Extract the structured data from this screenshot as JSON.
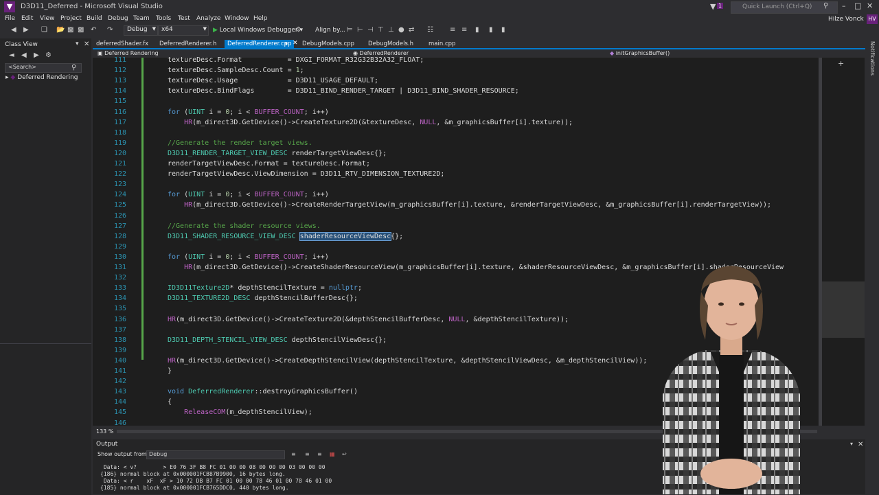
{
  "window": {
    "title": "D3D11_Deferred - Microsoft Visual Studio",
    "notifications_count": "1",
    "quick_launch_placeholder": "Quick Launch (Ctrl+Q)",
    "user": "Hilze Vonck",
    "avatar_initials": "HV"
  },
  "menu": [
    "File",
    "Edit",
    "View",
    "Project",
    "Build",
    "Debug",
    "Team",
    "Tools",
    "Test",
    "Analyze",
    "Window",
    "Help"
  ],
  "toolbar": {
    "configuration": "Debug",
    "platform": "x64",
    "debugger": "Local Windows Debugger",
    "align": "Align by..."
  },
  "class_view": {
    "title": "Class View",
    "search_placeholder": "<Search>",
    "item": "Deferred Rendering"
  },
  "tabs": [
    {
      "label": "deferredShader.fx",
      "active": false
    },
    {
      "label": "DeferredRenderer.h",
      "active": false
    },
    {
      "label": "DeferredRenderer.cpp",
      "active": true
    },
    {
      "label": "DebugModels.cpp",
      "active": false
    },
    {
      "label": "DebugModels.h",
      "active": false
    },
    {
      "label": "main.cpp",
      "active": false
    }
  ],
  "navbar": {
    "project": "Deferred Rendering",
    "scope": "DeferredRenderer",
    "member": "initGraphicsBuffer()"
  },
  "editor": {
    "zoom": "133 %",
    "lines": [
      {
        "n": "111",
        "t": "textureDesc.Format           = DXGI_FORMAT_R32G32B32A32_FLOAT;"
      },
      {
        "n": "112",
        "t": "textureDesc.SampleDesc.Count = 1;"
      },
      {
        "n": "113",
        "t": "textureDesc.Usage            = D3D11_USAGE_DEFAULT;"
      },
      {
        "n": "114",
        "t": "textureDesc.BindFlags        = D3D11_BIND_RENDER_TARGET | D3D11_BIND_SHADER_RESOURCE;"
      },
      {
        "n": "115",
        "t": ""
      },
      {
        "n": "116",
        "t": "for (UINT i = 0; i < BUFFER_COUNT; i++)"
      },
      {
        "n": "117",
        "t": "    HR(m_direct3D.GetDevice()->CreateTexture2D(&textureDesc, NULL, &m_graphicsBuffer[i].texture));"
      },
      {
        "n": "118",
        "t": ""
      },
      {
        "n": "119",
        "t": "//Generate the render target views."
      },
      {
        "n": "120",
        "t": "D3D11_RENDER_TARGET_VIEW_DESC renderTargetViewDesc{};"
      },
      {
        "n": "121",
        "t": "renderTargetViewDesc.Format = textureDesc.Format;"
      },
      {
        "n": "122",
        "t": "renderTargetViewDesc.ViewDimension = D3D11_RTV_DIMENSION_TEXTURE2D;"
      },
      {
        "n": "123",
        "t": ""
      },
      {
        "n": "124",
        "t": "for (UINT i = 0; i < BUFFER_COUNT; i++)"
      },
      {
        "n": "125",
        "t": "    HR(m_direct3D.GetDevice()->CreateRenderTargetView(m_graphicsBuffer[i].texture, &renderTargetViewDesc, &m_graphicsBuffer[i].renderTargetView));"
      },
      {
        "n": "126",
        "t": ""
      },
      {
        "n": "127",
        "t": "//Generate the shader resource views."
      },
      {
        "n": "128",
        "t": "D3D11_SHADER_RESOURCE_VIEW_DESC shaderResourceViewDesc{};"
      },
      {
        "n": "129",
        "t": ""
      },
      {
        "n": "130",
        "t": "for (UINT i = 0; i < BUFFER_COUNT; i++)"
      },
      {
        "n": "131",
        "t": "    HR(m_direct3D.GetDevice()->CreateShaderResourceView(m_graphicsBuffer[i].texture, &shaderResourceViewDesc, &m_graphicsBuffer[i].shaderResourceView"
      },
      {
        "n": "132",
        "t": ""
      },
      {
        "n": "133",
        "t": "ID3D11Texture2D* depthStencilTexture = nullptr;"
      },
      {
        "n": "134",
        "t": "D3D11_TEXTURE2D_DESC depthStencilBufferDesc{};"
      },
      {
        "n": "135",
        "t": ""
      },
      {
        "n": "136",
        "t": "HR(m_direct3D.GetDevice()->CreateTexture2D(&depthStencilBufferDesc, NULL, &depthStencilTexture));"
      },
      {
        "n": "137",
        "t": ""
      },
      {
        "n": "138",
        "t": "D3D11_DEPTH_STENCIL_VIEW_DESC depthStencilViewDesc{};"
      },
      {
        "n": "139",
        "t": ""
      },
      {
        "n": "140",
        "t": "HR(m_direct3D.GetDevice()->CreateDepthStencilView(depthStencilTexture, &depthStencilViewDesc, &m_depthStencilView));"
      },
      {
        "n": "141",
        "t": "}"
      },
      {
        "n": "142",
        "t": ""
      },
      {
        "n": "143",
        "t": "void DeferredRenderer::destroyGraphicsBuffer()"
      },
      {
        "n": "144",
        "t": "{"
      },
      {
        "n": "145",
        "t": "    ReleaseCOM(m_depthStencilView);"
      },
      {
        "n": "146",
        "t": ""
      }
    ]
  },
  "output": {
    "title": "Output",
    "show_from_label": "Show output from:",
    "show_from_value": "Debug",
    "lines": [
      " Data: < v?        > E0 76 3F B8 FC 01 00 00 08 00 00 00 03 00 00 00",
      "{186} normal block at 0x000001FCB87B9900, 16 bytes long.",
      " Data: < r    xF  xF > 10 72 DB B7 FC 01 00 00 78 46 01 00 78 46 01 00",
      "{185} normal block at 0x000001FCB765DDC0, 440 bytes long."
    ]
  }
}
